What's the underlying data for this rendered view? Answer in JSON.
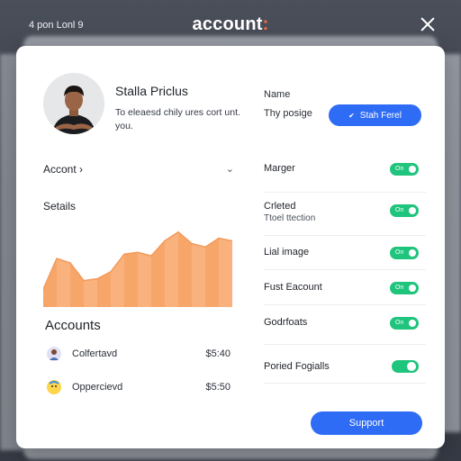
{
  "topbar": {
    "left_text": "4 pon Lonl 9",
    "title_main": "account",
    "title_suffix": ":"
  },
  "profile": {
    "name": "Stalla Priclus",
    "description": "To eleaesd chily ures cort unt. you."
  },
  "fields": {
    "name_label": "Name",
    "type_label": "Thy posige",
    "primary_button": "Stah Ferel"
  },
  "account_select": {
    "label": "Accont",
    "arrow": "›"
  },
  "stats": {
    "label": "Setails"
  },
  "chart_data": {
    "type": "area",
    "x": [
      0,
      1,
      2,
      3,
      4,
      5,
      6,
      7,
      8,
      9,
      10,
      11,
      12,
      13,
      14
    ],
    "values": [
      0.2,
      0.55,
      0.5,
      0.3,
      0.32,
      0.4,
      0.6,
      0.62,
      0.58,
      0.75,
      0.85,
      0.72,
      0.68,
      0.78,
      0.75
    ],
    "ylim": [
      0,
      1
    ],
    "color": "#f7a66a"
  },
  "accounts": {
    "title": "Accounts",
    "items": [
      {
        "name": "Colfertavd",
        "amount": "$5:40",
        "icon": "person-icon"
      },
      {
        "name": "Oppercievd",
        "amount": "$5:50",
        "icon": "emoji-icon"
      }
    ]
  },
  "settings": [
    {
      "title": "Marger",
      "subtitle": "",
      "toggle": "on",
      "toggle_text": "On"
    },
    {
      "title": "Crleted",
      "subtitle": "Ttoel ttection",
      "toggle": "on",
      "toggle_text": "On"
    },
    {
      "title": "Lial image",
      "subtitle": "",
      "toggle": "on",
      "toggle_text": "On"
    },
    {
      "title": "Fust Eacount",
      "subtitle": "",
      "toggle": "on",
      "toggle_text": "On"
    },
    {
      "title": "Godrfoats",
      "subtitle": "",
      "toggle": "on",
      "toggle_text": "On"
    },
    {
      "title": "Poried Fogialls",
      "subtitle": "",
      "toggle": "on",
      "toggle_text": ""
    }
  ],
  "support_button": "Support",
  "colors": {
    "accent_blue": "#2f6cf5",
    "toggle_green": "#1fc47d",
    "chart_orange": "#f7a66a",
    "title_dot": "#ff6a3d"
  }
}
